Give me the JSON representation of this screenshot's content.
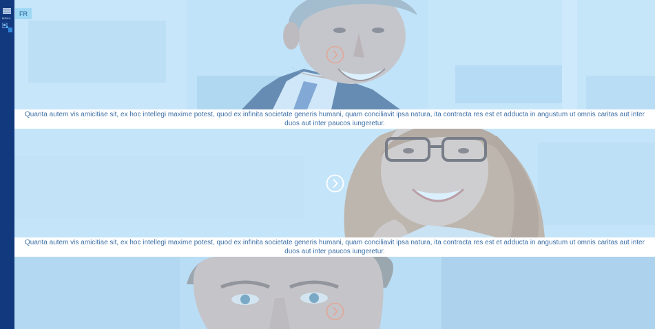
{
  "nav": {
    "menu_label": "MENU"
  },
  "language": {
    "label": "FR"
  },
  "testimonials": [
    {
      "text": "Quanta autem vis amicitiae sit, ex hoc intellegi maxime potest, quod ex infinita societate generis humani, quam conciliavit ipsa natura, ita contracta res est et adducta in angustum ut omnis caritas aut inter duos aut inter paucos iungeretur."
    },
    {
      "text": "Quanta autem vis amicitiae sit, ex hoc intellegi maxime potest, quod ex infinita societate generis humani, quam conciliavit ipsa natura, ita contracta res est et adducta in angustum ut omnis caritas aut inter duos aut inter paucos iungeretur."
    }
  ],
  "colors": {
    "rail": "#12387e",
    "accent": "#9fd8f5",
    "caption_text": "#3c6fa6",
    "overlay": "#b0defa"
  },
  "icons": {
    "nav_toggle": "hamburger-icon",
    "slide_next": "chevron-right-circle-icon"
  }
}
